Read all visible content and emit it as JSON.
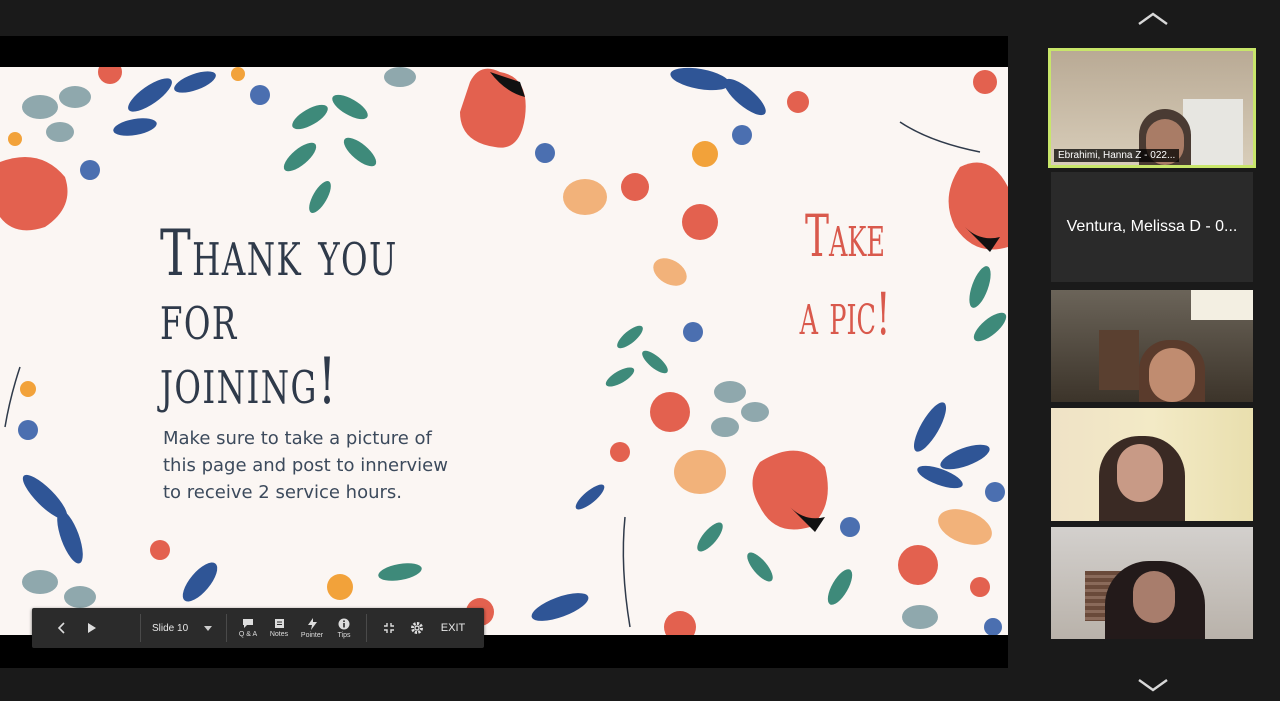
{
  "slide": {
    "title": "Thank you for joining!",
    "body": "Make sure to take a picture of this page and post to innerview to receive 2 service hours.",
    "callout": "Take a pic!"
  },
  "toolbar": {
    "slide_select": "Slide 10",
    "qa_label": "Q & A",
    "notes_label": "Notes",
    "pointer_label": "Pointer",
    "tips_label": "Tips",
    "exit_label": "EXIT"
  },
  "participants": [
    {
      "name": "Ebrahimi, Hanna Z - 022...",
      "video": true,
      "active_speaker": true
    },
    {
      "name": "Ventura, Melissa D - 0...",
      "video": false
    },
    {
      "video": true
    },
    {
      "video": true
    },
    {
      "video": true
    }
  ],
  "icons": {
    "scroll_up": "chevron-up-icon",
    "scroll_down": "chevron-down-icon",
    "prev": "chevron-left-icon",
    "play": "play-icon",
    "qa": "chat-bubble-icon",
    "notes": "notes-icon",
    "pointer": "pointer-bolt-icon",
    "tips": "info-icon",
    "exit_fullscreen": "collapse-icon",
    "settings": "gear-icon"
  },
  "colors": {
    "active_speaker_border": "#c8e66a",
    "slide_bg": "#fbf6f3",
    "title_color": "#2f3a4a",
    "callout_color": "#d9594c"
  }
}
